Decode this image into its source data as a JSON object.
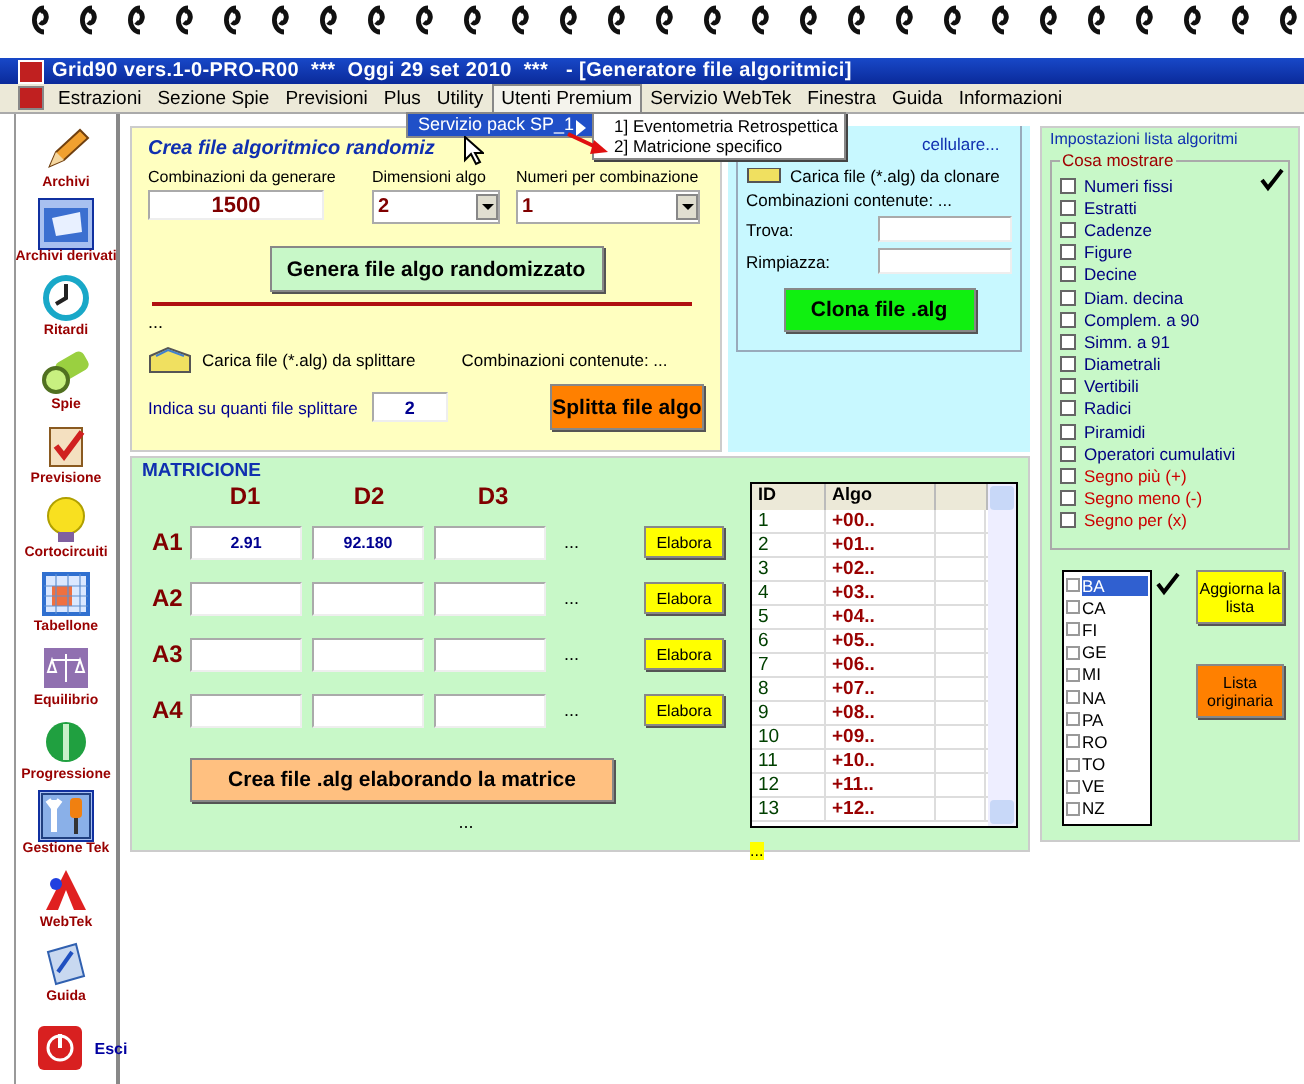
{
  "window": {
    "title": "Grid90 vers.1-0-PRO-R00  ***  Oggi 29 set 2010  ***   - [Generatore file algoritmici]"
  },
  "menu": [
    {
      "label": "Estrazioni",
      "selected": false
    },
    {
      "label": "Sezione Spie",
      "selected": false
    },
    {
      "label": "Previsioni",
      "selected": false
    },
    {
      "label": "Plus",
      "selected": false
    },
    {
      "label": "Utility",
      "selected": false
    },
    {
      "label": "Utenti Premium",
      "selected": true
    },
    {
      "label": "Servizio WebTek",
      "selected": false
    },
    {
      "label": "Finestra",
      "selected": false
    },
    {
      "label": "Guida",
      "selected": false
    },
    {
      "label": "Informazioni",
      "selected": false
    }
  ],
  "submenu": {
    "label": "Servizio pack SP_1",
    "selected": true,
    "items": [
      "1] Eventometria Retrospettica",
      "2] Matricione specifico"
    ]
  },
  "sidebar": [
    {
      "label": "Archivi",
      "kind": "pencil",
      "selected": false
    },
    {
      "label": "Archivi derivati",
      "kind": "folder",
      "selected": true
    },
    {
      "label": "Ritardi",
      "kind": "clock",
      "selected": false
    },
    {
      "label": "Spie",
      "kind": "torch",
      "selected": false
    },
    {
      "label": "Previsione",
      "kind": "clipboard",
      "selected": false
    },
    {
      "label": "Cortocircuiti",
      "kind": "bulb",
      "selected": false
    },
    {
      "label": "Tabellone",
      "kind": "calendar",
      "selected": false
    },
    {
      "label": "Equilibrio",
      "kind": "scales",
      "selected": false
    },
    {
      "label": "Progressione",
      "kind": "coin",
      "selected": false
    },
    {
      "label": "Gestione Tek",
      "kind": "tools",
      "selected": true
    },
    {
      "label": "WebTek",
      "kind": "triangle",
      "selected": false
    },
    {
      "label": "Guida",
      "kind": "book",
      "selected": false
    },
    {
      "label": "Esci",
      "kind": "power",
      "selected": false
    }
  ],
  "random_panel": {
    "title": "Crea file algoritmico randomiz",
    "combinations": {
      "label": "Combinazioni da generare",
      "value": "1500"
    },
    "dimension": {
      "label": "Dimensioni algo",
      "value": "2"
    },
    "numbers": {
      "label": "Numeri per combinazione",
      "value": "1"
    },
    "generate_button": "Genera file algo randomizzato",
    "status": "...",
    "load_label": "Carica file (*.alg) da splittare",
    "contents_label": "Combinazioni contenute: ...",
    "split_label": "Indica su quanti file splittare",
    "split_value": "2",
    "split_button": "Splitta file algo"
  },
  "clone_panel": {
    "title": "cellulare...",
    "load_label": "Carica file (*.alg) da clonare",
    "contents_label": "Combinazioni contenute: ...",
    "find_label": "Trova:",
    "replace_label": "Rimpiazza:",
    "clone_button": "Clona file .alg"
  },
  "list_panel": {
    "title": "Impostazioni lista algoritmi",
    "group_title": "Cosa mostrare",
    "options": [
      {
        "label": "Numeri fissi",
        "checked": false,
        "color": "#000080"
      },
      {
        "label": "Estratti",
        "checked": false,
        "color": "#000080"
      },
      {
        "label": "Cadenze",
        "checked": false,
        "color": "#000080"
      },
      {
        "label": "Figure",
        "checked": false,
        "color": "#000080"
      },
      {
        "label": "Decine",
        "checked": false,
        "color": "#000080"
      },
      {
        "label": "Diam. decina",
        "checked": false,
        "color": "#000080"
      },
      {
        "label": "Complem. a 90",
        "checked": false,
        "color": "#000080"
      },
      {
        "label": "Simm. a 91",
        "checked": false,
        "color": "#000080"
      },
      {
        "label": "Diametrali",
        "checked": false,
        "color": "#000080"
      },
      {
        "label": "Vertibili",
        "checked": false,
        "color": "#000080"
      },
      {
        "label": "Radici",
        "checked": false,
        "color": "#000080"
      },
      {
        "label": "Piramidi",
        "checked": false,
        "color": "#000080"
      },
      {
        "label": "Operatori cumulativi",
        "checked": false,
        "color": "#000080"
      },
      {
        "label": "Segno più (+)",
        "checked": false,
        "color": "#cc0000"
      },
      {
        "label": "Segno meno (-)",
        "checked": false,
        "color": "#cc0000"
      },
      {
        "label": "Segno per (x)",
        "checked": false,
        "color": "#cc0000"
      }
    ],
    "cities": [
      {
        "label": "BA",
        "checked": false,
        "selected": true
      },
      {
        "label": "CA",
        "checked": false,
        "selected": false
      },
      {
        "label": "FI",
        "checked": false,
        "selected": false
      },
      {
        "label": "GE",
        "checked": false,
        "selected": false
      },
      {
        "label": "MI",
        "checked": false,
        "selected": false
      },
      {
        "label": "NA",
        "checked": false,
        "selected": false
      },
      {
        "label": "PA",
        "checked": false,
        "selected": false
      },
      {
        "label": "RO",
        "checked": false,
        "selected": false
      },
      {
        "label": "TO",
        "checked": false,
        "selected": false
      },
      {
        "label": "VE",
        "checked": false,
        "selected": false
      },
      {
        "label": "NZ",
        "checked": false,
        "selected": false
      }
    ],
    "update_button": "Aggiorna la lista",
    "original_button": "Lista originaria"
  },
  "matrix": {
    "title": "MATRICIONE",
    "columns": [
      "D1",
      "D2",
      "D3"
    ],
    "rows": [
      {
        "label": "A1",
        "cells": [
          {
            "value": "2.91"
          },
          {
            "value": "92.180"
          },
          {}
        ],
        "more": "...",
        "button": "Elabora"
      },
      {
        "label": "A2",
        "cells": [
          {},
          {},
          {}
        ],
        "more": "...",
        "button": "Elabora"
      },
      {
        "label": "A3",
        "cells": [
          {},
          {},
          {}
        ],
        "more": "...",
        "button": "Elabora"
      },
      {
        "label": "A4",
        "cells": [
          {},
          {},
          {}
        ],
        "more": "...",
        "button": "Elabora"
      }
    ],
    "create_button": "Crea file .alg elaborando la matrice",
    "status": "...",
    "table": {
      "columns": [
        "ID",
        "Algo"
      ],
      "rows": [
        {
          "id": "1",
          "algo": "+00.."
        },
        {
          "id": "2",
          "algo": "+01.."
        },
        {
          "id": "3",
          "algo": "+02.."
        },
        {
          "id": "4",
          "algo": "+03.."
        },
        {
          "id": "5",
          "algo": "+04.."
        },
        {
          "id": "6",
          "algo": "+05.."
        },
        {
          "id": "7",
          "algo": "+06.."
        },
        {
          "id": "8",
          "algo": "+07.."
        },
        {
          "id": "9",
          "algo": "+08.."
        },
        {
          "id": "10",
          "algo": "+09.."
        },
        {
          "id": "11",
          "algo": "+10.."
        },
        {
          "id": "12",
          "algo": "+11.."
        },
        {
          "id": "13",
          "algo": "+12.."
        }
      ]
    },
    "table_status": "..."
  }
}
